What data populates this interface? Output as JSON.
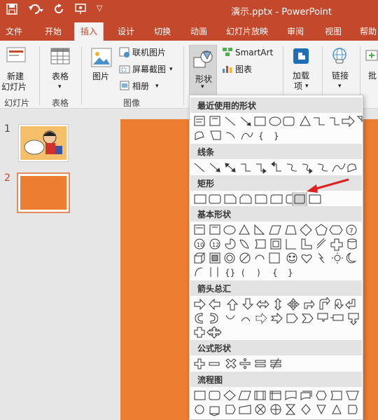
{
  "titlebar": {
    "title": "演示.pptx  -  PowerPoint"
  },
  "tabs": [
    "文件",
    "开始",
    "插入",
    "设计",
    "切换",
    "动画",
    "幻灯片放映",
    "审阅",
    "视图",
    "帮助"
  ],
  "active_tab": "插入",
  "ribbon": {
    "new_slide": "新建\n幻灯片",
    "new_slide_line1": "新建",
    "new_slide_line2": "幻灯片",
    "table": "表格",
    "picture": "图片",
    "online_picture": "联机图片",
    "screenshot": "屏幕截图",
    "album": "相册",
    "shapes": "形状",
    "smartart": "SmartArt",
    "chart": "图表",
    "addin_line1": "加载",
    "addin_line2": "项",
    "link": "链接",
    "partial_next": "批",
    "groups": {
      "slides": "幻灯片",
      "tables": "表格",
      "images": "图像"
    }
  },
  "slides": [
    {
      "number": "1"
    },
    {
      "number": "2"
    }
  ],
  "shapes_menu": {
    "recent": "最近使用的形状",
    "lines": "线条",
    "rectangles": "矩形",
    "basic": "基本形状",
    "arrows": "箭头总汇",
    "equation": "公式形状",
    "flowchart": "流程图"
  },
  "colors": {
    "accent": "#c4482b",
    "slide_fill": "#ed7d31"
  }
}
